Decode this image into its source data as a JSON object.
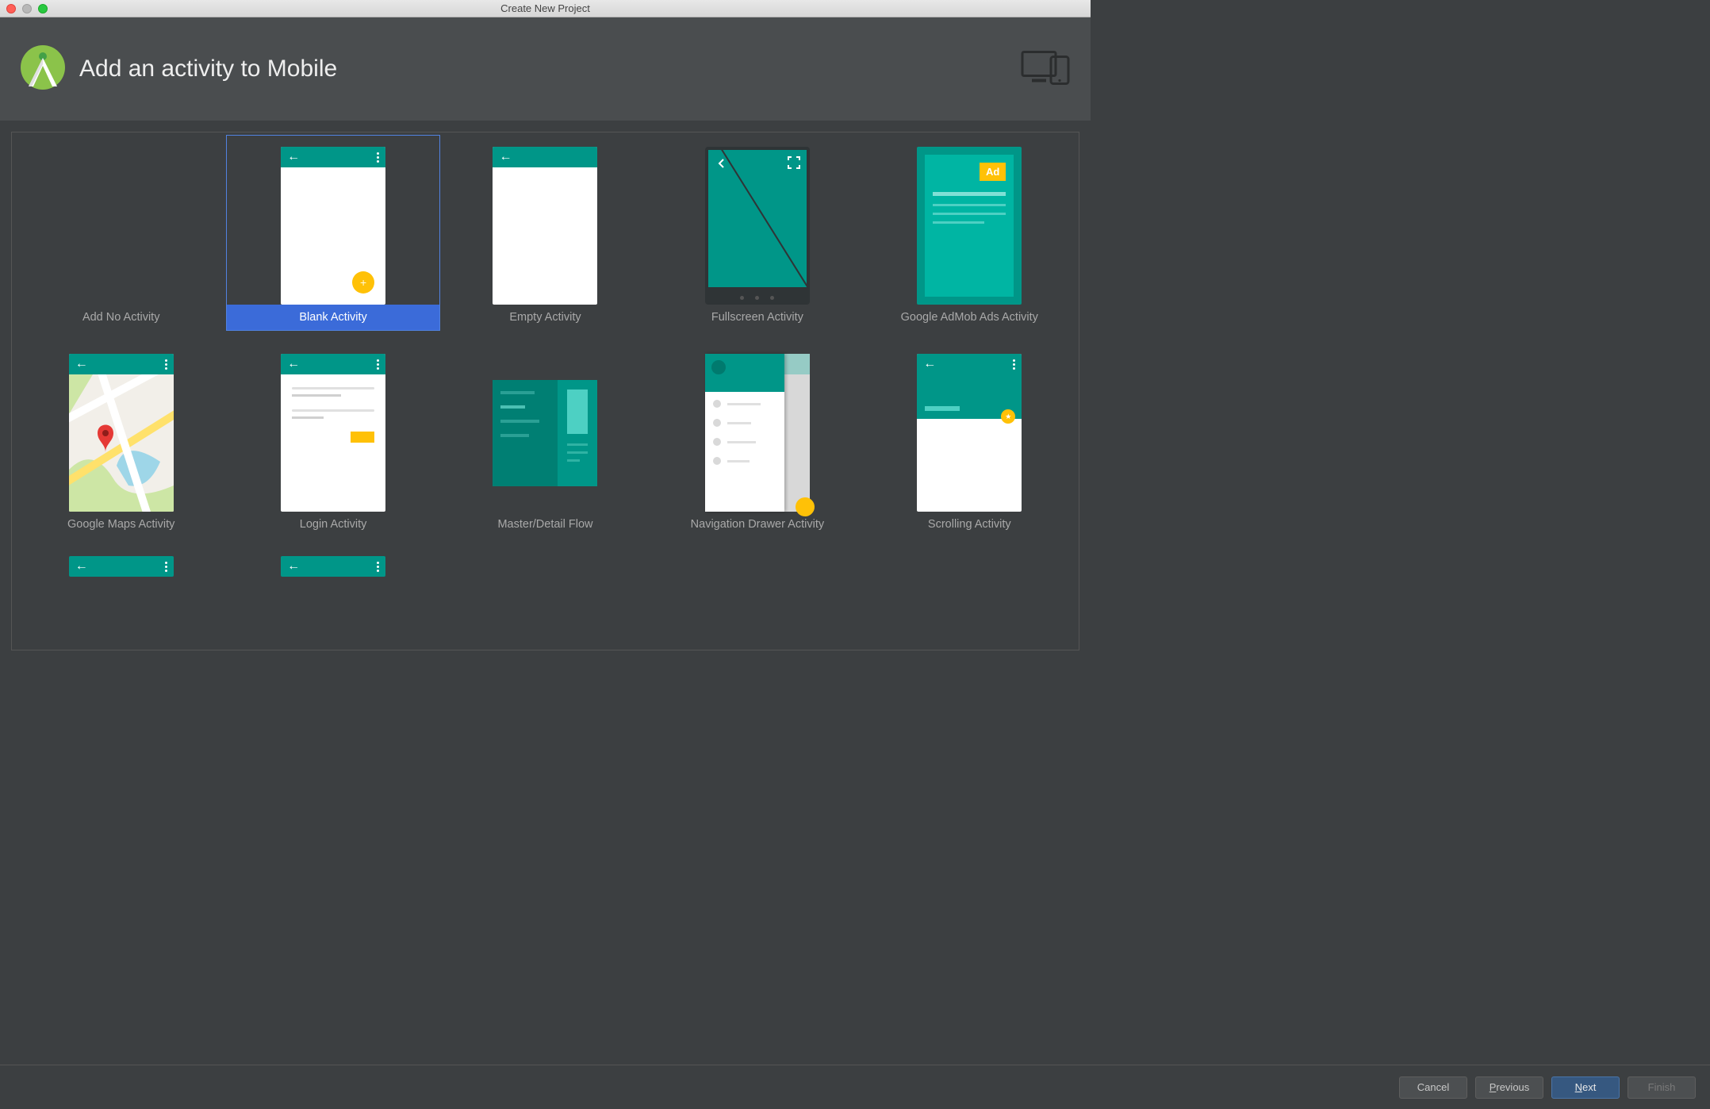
{
  "window": {
    "title": "Create New Project"
  },
  "header": {
    "title": "Add an activity to Mobile"
  },
  "activities": [
    {
      "id": "none",
      "label": "Add No Activity",
      "selected": false
    },
    {
      "id": "blank",
      "label": "Blank Activity",
      "selected": true
    },
    {
      "id": "empty",
      "label": "Empty Activity",
      "selected": false
    },
    {
      "id": "fullscreen",
      "label": "Fullscreen Activity",
      "selected": false
    },
    {
      "id": "admob",
      "label": "Google AdMob Ads Activity",
      "selected": false,
      "ad_badge": "Ad"
    },
    {
      "id": "maps",
      "label": "Google Maps Activity",
      "selected": false
    },
    {
      "id": "login",
      "label": "Login Activity",
      "selected": false
    },
    {
      "id": "masterdetail",
      "label": "Master/Detail Flow",
      "selected": false
    },
    {
      "id": "navdrawer",
      "label": "Navigation Drawer Activity",
      "selected": false
    },
    {
      "id": "scrolling",
      "label": "Scrolling Activity",
      "selected": false
    }
  ],
  "footer": {
    "cancel": "Cancel",
    "previous_mnemonic": "P",
    "previous_rest": "revious",
    "next_mnemonic": "N",
    "next_rest": "ext",
    "finish": "Finish"
  },
  "colors": {
    "teal": "#009688",
    "amber": "#ffc107",
    "selection": "#3b6bd9"
  }
}
